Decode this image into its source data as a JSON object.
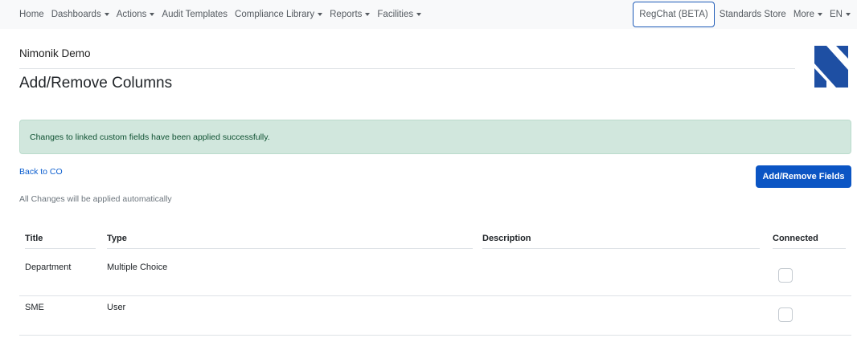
{
  "nav": {
    "left_items": [
      {
        "label": "Home",
        "dropdown": false
      },
      {
        "label": "Dashboards",
        "dropdown": true
      },
      {
        "label": "Actions",
        "dropdown": true
      },
      {
        "label": "Audit Templates",
        "dropdown": false
      },
      {
        "label": "Compliance Library",
        "dropdown": true
      },
      {
        "label": "Reports",
        "dropdown": true
      },
      {
        "label": "Facilities",
        "dropdown": true
      }
    ],
    "regchat_label": "RegChat (BETA)",
    "standards_store_label": "Standards Store",
    "more_label": "More",
    "language_label": "EN"
  },
  "header": {
    "org_name": "Nimonik Demo",
    "page_title": "Add/Remove Columns",
    "logo_color": "#1e4fa3"
  },
  "alert": {
    "message": "Changes to linked custom fields have been applied successfully.",
    "bg_color": "#d1e7dd",
    "text_color": "#0f5132"
  },
  "actions": {
    "back_link": "Back to CO",
    "add_remove_fields_label": "Add/Remove Fields",
    "hint": "All Changes will be applied automatically",
    "primary_color": "#0b55c4"
  },
  "table": {
    "headers": {
      "title": "Title",
      "type": "Type",
      "description": "Description",
      "connected": "Connected"
    },
    "rows": [
      {
        "title": "Department",
        "type": "Multiple Choice",
        "description": "",
        "connected": false
      },
      {
        "title": "SME",
        "type": "User",
        "description": "",
        "connected": false
      }
    ]
  }
}
